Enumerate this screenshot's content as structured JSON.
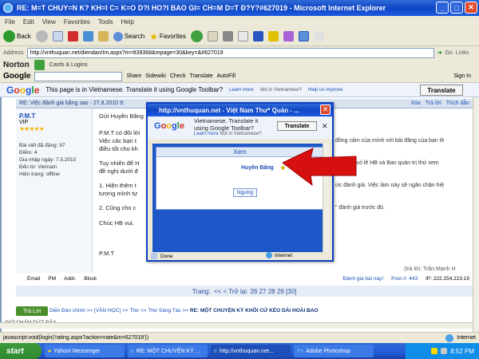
{
  "window": {
    "title": "RE: M=T CHUY=N K? KH=I C= K=O D?I HO?I BAO GI= CH=M D=T Đ?Y?#627019 - Microsoft Internet Explorer"
  },
  "menu": [
    "File",
    "Edit",
    "View",
    "Favorites",
    "Tools",
    "Help"
  ],
  "toolbar": {
    "back": "Back",
    "search": "Search",
    "favorites": "Favorites"
  },
  "address": {
    "label": "Address",
    "url": "http://vnthuquan.net/diendan/tm.aspx?m=839368&mpage=30&key=&#627019",
    "go": "Go",
    "links": "Links"
  },
  "norton": {
    "logo": "Norton",
    "cards": "Cards & Logins"
  },
  "google_toolbar": {
    "logo": "Google",
    "share": "Share",
    "sidewiki": "Sidewiki",
    "check": "Check",
    "translate": "Translate",
    "autofill": "AutoFill",
    "signin": "Sign In"
  },
  "translate_bar": {
    "message": "This page is in Vietnamese.  Translate it using Google Toolbar?",
    "learn_more": "Learn more",
    "not_vietnamese": "Not in Vietnamese?",
    "help": "Help us improve",
    "button": "Translate"
  },
  "post": {
    "header": "RE: Việc đánh giá bằng sao - 27.8.2010 9:",
    "user": "P.M.T",
    "rank": "VIP",
    "stars": "★★★★★",
    "info": [
      "Bài viết đã đăng: 97",
      "Điểm: 4",
      "Gia nhập ngày: 7.5.2010",
      "Đến từ: Vietnam",
      "Hiện trạng: offline"
    ],
    "lines": [
      "Gửi Huyền Băng",
      "P.M.T có đôi lời",
      "Việc cảc bạn t",
      "điều tốt cho kh",
      "Tuy nhiên để H",
      "đề nghị dưới đ",
      "1. Hiện thêm t",
      "tượng mình tự",
      "2. Cũng cho c",
      "Chúc HB vui.",
      "P.M.T"
    ],
    "right_fragments": [
      "đồng cảm của mình với bài đăng của bạn th",
      "n Hùng, có lẽ HB và Ban quản trị thử xem",
      "ức đánh giá. Việc làm này sẽ ngăn chặn hiệ",
      "\" đánh giá trước đó."
    ],
    "actions": [
      "Xóa",
      "Trả lời",
      "Trích dẫn"
    ],
    "signature": "(trả lời: Trần Mạnh H",
    "footer_links": [
      "Email",
      "PM",
      "Addr.",
      "Block"
    ],
    "rate": "Đánh giá bài này!",
    "post_no": "Post #: 443",
    "ip": "IP: 222.254.223.19"
  },
  "pager": {
    "label": "Trang:",
    "prev": "<<  < Trở lại",
    "pages": "26 27 28 29 [30]"
  },
  "breadcrumb": {
    "reply": "Trả Lời",
    "path": "Diễn Đàn chính >> [VĂN HỌC] >> Thơ >> Thơ Sáng Tác >>",
    "current": "RE: MỘT CHUYỆN KỲ KHÔI CỨ KÉO DÀI HOÀI BAO",
    "sub": "GIỜ CHẤM DỨT ĐÂY"
  },
  "status": {
    "text": "javascript:void(login('rating.aspx?action=rate&m=627019'))",
    "zone": "Internet"
  },
  "popup": {
    "title": "http://vnthuquan.net - Việt Nam Thư* Quán - ...",
    "trans_msg": "Vietnamese.  Translate it using Google Toolbar?",
    "trans_btn": "Translate",
    "learn_more": "Learn more",
    "not_vn": "Not in Vietnamese?",
    "xem": "Xem",
    "user": "Huyền Băng",
    "ngung": "Ngưng",
    "status": "Done",
    "zone": "Internet"
  },
  "taskbar": {
    "start": "start",
    "tasks": [
      "Yahoo! Messenger",
      "RE: MỘT CHUYỆN KỲ ...",
      "http://vnthuquan.net...",
      "Adobe Photoshop"
    ],
    "time": "8:52 PM"
  },
  "colors": {
    "xp_blue": "#0f45c4",
    "link_blue": "#1b4fb4",
    "arrow_red": "#d60f0f"
  }
}
